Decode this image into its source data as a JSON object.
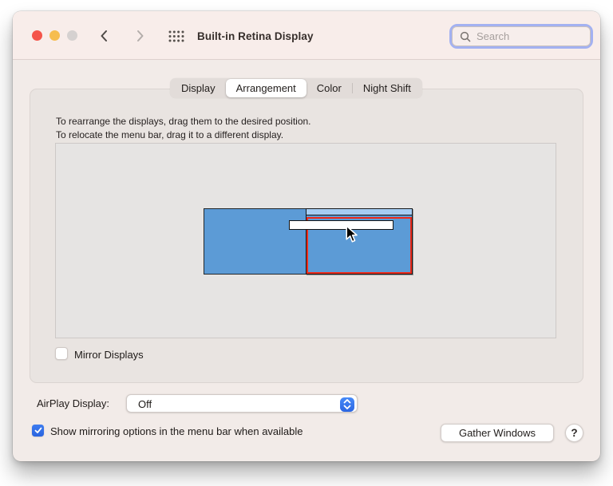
{
  "titlebar": {
    "title": "Built-in Retina Display",
    "search_placeholder": "Search"
  },
  "tabs": [
    {
      "label": "Display",
      "selected": false
    },
    {
      "label": "Arrangement",
      "selected": true
    },
    {
      "label": "Color",
      "selected": false
    },
    {
      "label": "Night Shift",
      "selected": false
    }
  ],
  "instructions": {
    "line1": "To rearrange the displays, drag them to the desired position.",
    "line2": "To relocate the menu bar, drag it to a different display."
  },
  "arrangement": {
    "displays": [
      {
        "name": "left-display",
        "highlighted": false
      },
      {
        "name": "right-display",
        "highlighted": true,
        "highlight_color": "#ee2a19"
      }
    ],
    "menu_bar_state": "being-dragged-between-displays"
  },
  "mirror": {
    "label": "Mirror Displays",
    "checked": false
  },
  "airplay": {
    "label": "AirPlay Display:",
    "value": "Off"
  },
  "footer": {
    "mirroring_label": "Show mirroring options in the menu bar when available",
    "mirroring_checked": true,
    "gather_button": "Gather Windows",
    "help_button": "?"
  },
  "colors": {
    "display_blue": "#5c9bd6",
    "menubar_strip_blue": "#a6cdf3",
    "highlight_red": "#ee2a19",
    "accent_blue": "#2e6de6",
    "focus_ring": "#a3b1f1",
    "window_bg": "#f2ebe8",
    "titlebar_bg": "#f8edea"
  }
}
